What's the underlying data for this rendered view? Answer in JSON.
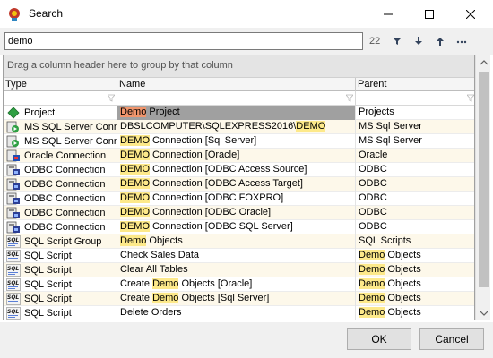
{
  "window": {
    "title": "Search"
  },
  "search": {
    "value": "demo",
    "count": "22"
  },
  "grid": {
    "group_hint": "Drag a column header here to group by that column",
    "columns": [
      "Type",
      "Name",
      "Parent"
    ],
    "rows": [
      {
        "type": "Project",
        "icon": "project-icon",
        "name_segments": [
          [
            "Demo",
            "hlsel"
          ],
          [
            " Project",
            ""
          ]
        ],
        "parent_segments": [
          [
            "Projects",
            ""
          ]
        ],
        "selected": true,
        "alt": false
      },
      {
        "type": "MS SQL Server Conne",
        "icon": "sqlserver-connection-icon",
        "name_segments": [
          [
            "DBSLCOMPUTER\\SQLEXPRESS2016\\",
            ""
          ],
          [
            "DEMO",
            "hl"
          ]
        ],
        "parent_segments": [
          [
            "MS Sql Server",
            ""
          ]
        ],
        "selected": false,
        "alt": true
      },
      {
        "type": "MS SQL Server Conne",
        "icon": "sqlserver-connection-icon",
        "name_segments": [
          [
            "DEMO",
            "hl"
          ],
          [
            " Connection [Sql Server]",
            ""
          ]
        ],
        "parent_segments": [
          [
            "MS Sql Server",
            ""
          ]
        ],
        "selected": false,
        "alt": false
      },
      {
        "type": "Oracle Connection",
        "icon": "oracle-connection-icon",
        "name_segments": [
          [
            "DEMO",
            "hl"
          ],
          [
            " Connection [Oracle]",
            ""
          ]
        ],
        "parent_segments": [
          [
            "Oracle",
            ""
          ]
        ],
        "selected": false,
        "alt": true
      },
      {
        "type": "ODBC Connection",
        "icon": "odbc-connection-icon",
        "name_segments": [
          [
            "DEMO",
            "hl"
          ],
          [
            " Connection [ODBC Access Source]",
            ""
          ]
        ],
        "parent_segments": [
          [
            "ODBC",
            ""
          ]
        ],
        "selected": false,
        "alt": false
      },
      {
        "type": "ODBC Connection",
        "icon": "odbc-connection-icon",
        "name_segments": [
          [
            "DEMO",
            "hl"
          ],
          [
            " Connection [ODBC Access Target]",
            ""
          ]
        ],
        "parent_segments": [
          [
            "ODBC",
            ""
          ]
        ],
        "selected": false,
        "alt": true
      },
      {
        "type": "ODBC Connection",
        "icon": "odbc-connection-icon",
        "name_segments": [
          [
            "DEMO",
            "hl"
          ],
          [
            " Connection [ODBC FOXPRO]",
            ""
          ]
        ],
        "parent_segments": [
          [
            "ODBC",
            ""
          ]
        ],
        "selected": false,
        "alt": false
      },
      {
        "type": "ODBC Connection",
        "icon": "odbc-connection-icon",
        "name_segments": [
          [
            "DEMO",
            "hl"
          ],
          [
            " Connection [ODBC Oracle]",
            ""
          ]
        ],
        "parent_segments": [
          [
            "ODBC",
            ""
          ]
        ],
        "selected": false,
        "alt": true
      },
      {
        "type": "ODBC Connection",
        "icon": "odbc-connection-icon",
        "name_segments": [
          [
            "DEMO",
            "hl"
          ],
          [
            " Connection [ODBC SQL Server]",
            ""
          ]
        ],
        "parent_segments": [
          [
            "ODBC",
            ""
          ]
        ],
        "selected": false,
        "alt": false
      },
      {
        "type": "SQL Script Group",
        "icon": "sql-script-icon",
        "name_segments": [
          [
            "Demo",
            "hl"
          ],
          [
            " Objects",
            ""
          ]
        ],
        "parent_segments": [
          [
            "SQL Scripts",
            ""
          ]
        ],
        "selected": false,
        "alt": true
      },
      {
        "type": "SQL Script",
        "icon": "sql-script-icon",
        "name_segments": [
          [
            "Check Sales Data",
            ""
          ]
        ],
        "parent_segments": [
          [
            "Demo",
            "hl"
          ],
          [
            " Objects",
            ""
          ]
        ],
        "selected": false,
        "alt": false
      },
      {
        "type": "SQL Script",
        "icon": "sql-script-icon",
        "name_segments": [
          [
            "Clear All Tables",
            ""
          ]
        ],
        "parent_segments": [
          [
            "Demo",
            "hl"
          ],
          [
            " Objects",
            ""
          ]
        ],
        "selected": false,
        "alt": true
      },
      {
        "type": "SQL Script",
        "icon": "sql-script-icon",
        "name_segments": [
          [
            "Create ",
            ""
          ],
          [
            "Demo",
            "hl"
          ],
          [
            " Objects [Oracle]",
            ""
          ]
        ],
        "parent_segments": [
          [
            "Demo",
            "hl"
          ],
          [
            " Objects",
            ""
          ]
        ],
        "selected": false,
        "alt": false
      },
      {
        "type": "SQL Script",
        "icon": "sql-script-icon",
        "name_segments": [
          [
            "Create ",
            ""
          ],
          [
            "Demo",
            "hl"
          ],
          [
            " Objects [Sql Server]",
            ""
          ]
        ],
        "parent_segments": [
          [
            "Demo",
            "hl"
          ],
          [
            " Objects",
            ""
          ]
        ],
        "selected": false,
        "alt": true
      },
      {
        "type": "SQL Script",
        "icon": "sql-script-icon",
        "name_segments": [
          [
            "Delete Orders",
            ""
          ]
        ],
        "parent_segments": [
          [
            "Demo",
            "hl"
          ],
          [
            " Objects",
            ""
          ]
        ],
        "selected": false,
        "alt": false
      }
    ]
  },
  "footer": {
    "ok_label": "OK",
    "cancel_label": "Cancel"
  },
  "toolbar": {
    "icons": [
      "filter-icon",
      "arrow-down-icon",
      "arrow-up-icon",
      "more-icon"
    ]
  }
}
